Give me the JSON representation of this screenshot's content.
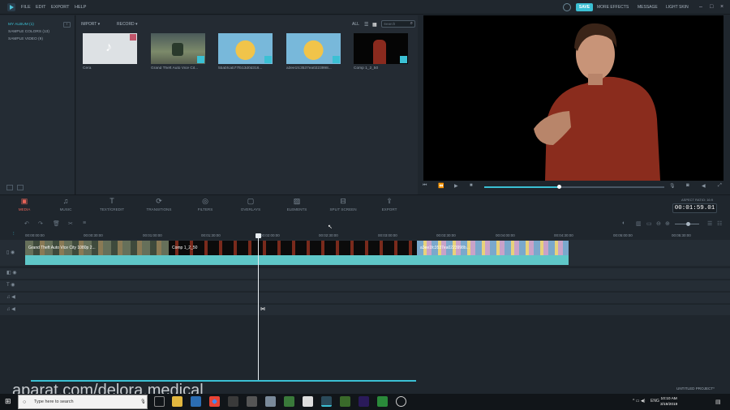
{
  "menubar": {
    "items": [
      "FILE",
      "EDIT",
      "EXPORT",
      "HELP"
    ],
    "save": "SAVE",
    "right": [
      "MORE EFFECTS",
      "MESSAGE",
      "LIGHT SKIN"
    ]
  },
  "sidebar": {
    "items": [
      "MY ALBUM (1)",
      "SAMPLE COLORS (13)",
      "SAMPLE VIDEO (9)"
    ]
  },
  "media": {
    "import": "IMPORT",
    "record": "RECORD",
    "all": "ALL",
    "search_placeholder": "Search",
    "items": [
      {
        "label": "Cera"
      },
      {
        "label": "Grand Theft Auto Vice Cit..."
      },
      {
        "label": "5babfcab77fb13d0d316..."
      },
      {
        "label": "a3ee1fc3537ea0223998..."
      },
      {
        "label": "Comp 1_2_50"
      }
    ]
  },
  "tabs": [
    {
      "label": "MEDIA",
      "icon": "media-icon"
    },
    {
      "label": "MUSIC",
      "icon": "music-icon"
    },
    {
      "label": "TEXT/CREDIT",
      "icon": "text-icon"
    },
    {
      "label": "TRANSITIONS",
      "icon": "transitions-icon"
    },
    {
      "label": "FILTERS",
      "icon": "filters-icon"
    },
    {
      "label": "OVERLAYS",
      "icon": "overlays-icon"
    },
    {
      "label": "ELEMENTS",
      "icon": "elements-icon"
    },
    {
      "label": "SPLIT SCREEN",
      "icon": "split-screen-icon"
    },
    {
      "label": "EXPORT",
      "icon": "export-icon"
    }
  ],
  "aspect": "ASPECT RATIO: 16:9",
  "time": "00:01:59.01",
  "ruler": [
    "00:00:00:00",
    "00:00:30:00",
    "00:01:00:00",
    "00:01:30:00",
    "00:02:00:00",
    "00:02:30:00",
    "00:03:00:00",
    "00:03:30:00",
    "00:04:00:00",
    "00:04:30:00",
    "00:05:00:00",
    "00:05:30:00"
  ],
  "clips": [
    {
      "title": "Grand Theft Auto Vice City 1080p 2..."
    },
    {
      "title": "Comp 1_2_50"
    },
    {
      "title": "a3ee1fc3537ea0223998b..."
    }
  ],
  "playhead_seconds": 119,
  "preview_progress": 0.42,
  "project": "UNTITLED PROJECT*",
  "watermark": "aparat.com/delora.medical",
  "taskbar": {
    "search": "Type here to search",
    "time": "10:10 AM",
    "date": "3/19/2019",
    "lang": "ENG"
  },
  "colors": {
    "accent": "#3bc0d4",
    "active_tab": "#e86458",
    "audio_track": "#5fc7c8"
  }
}
